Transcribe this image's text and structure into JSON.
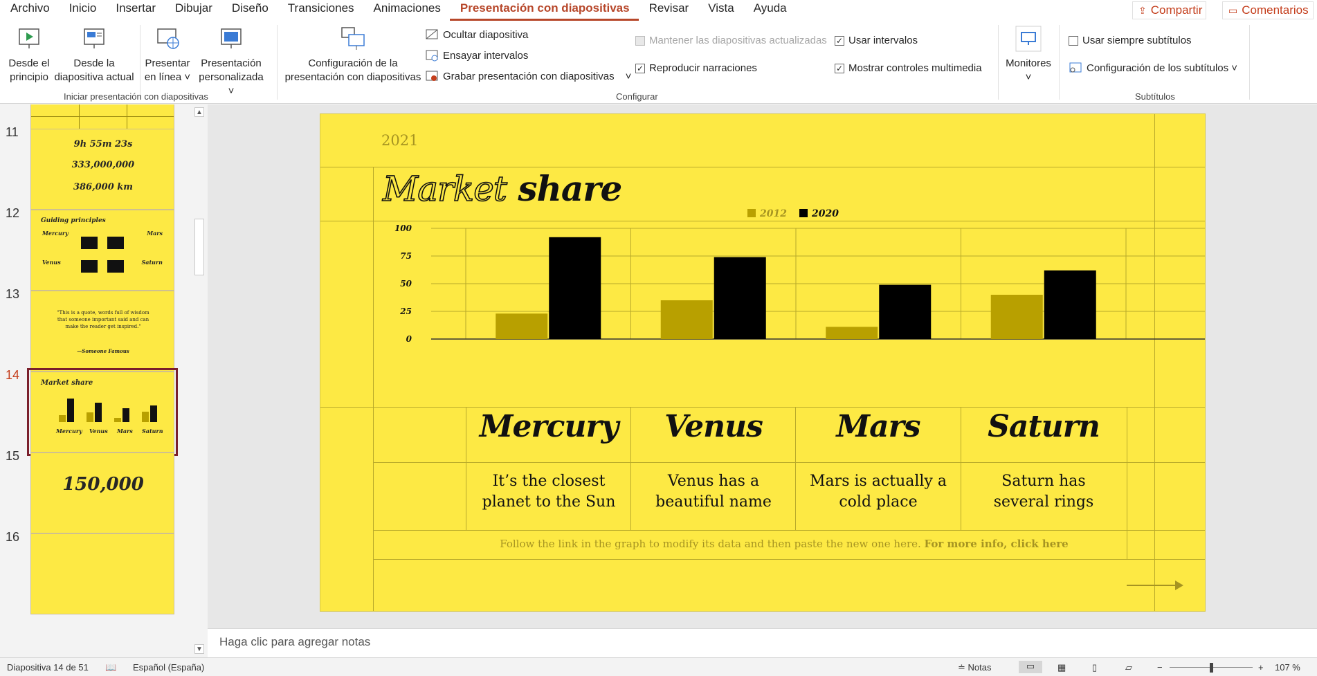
{
  "menu": {
    "tabs": [
      "Archivo",
      "Inicio",
      "Insertar",
      "Dibujar",
      "Diseño",
      "Transiciones",
      "Animaciones",
      "Presentación con diapositivas",
      "Revisar",
      "Vista",
      "Ayuda"
    ],
    "active_tab": "Presentación con diapositivas",
    "share_label": "Compartir",
    "comments_label": "Comentarios"
  },
  "ribbon": {
    "start": {
      "from_beginning": [
        "Desde el",
        "principio"
      ],
      "from_current": [
        "Desde la",
        "diapositiva actual"
      ],
      "present_online": [
        "Presentar",
        "en línea ˅"
      ],
      "custom_show": [
        "Presentación",
        "personalizada ˅"
      ],
      "group_label": "Iniciar presentación con diapositivas"
    },
    "setup": {
      "config_show": [
        "Configuración de la",
        "presentación con diapositivas"
      ],
      "hide_slide": "Ocultar diapositiva",
      "rehearse": "Ensayar intervalos",
      "record": "Grabar presentación con diapositivas",
      "record_caret": "˅",
      "keep_updated": "Mantener las diapositivas actualizadas",
      "play_narrations": "Reproducir narraciones",
      "use_timings": "Usar intervalos",
      "show_media_controls": "Mostrar controles multimedia",
      "group_label": "Configurar"
    },
    "monitors": {
      "label": "Monitores",
      "caret": "˅"
    },
    "subtitles": {
      "always_use": "Usar siempre subtítulos",
      "settings": "Configuración de los subtítulos ˅",
      "group_label": "Subtítulos"
    }
  },
  "thumbnails": [
    {
      "num": "11",
      "lines": [
        "9h 55m 23s",
        "333,000,000",
        "386,000 km"
      ]
    },
    {
      "num": "12",
      "title": "Guiding principles",
      "labels": [
        "Mercury",
        "Mars",
        "Venus",
        "Saturn"
      ]
    },
    {
      "num": "13",
      "quote": "\"This is a quote, words full of wisdom that someone important said and can make the reader get inspired.\"",
      "author": "—Someone Famous"
    },
    {
      "num": "14",
      "title": "Market share",
      "labels": [
        "Mercury",
        "Venus",
        "Mars",
        "Saturn"
      ]
    },
    {
      "num": "15",
      "big": "150,000"
    },
    {
      "num": "16"
    }
  ],
  "active_thumbnail": "14",
  "slide": {
    "year": "2021",
    "title_outline": "Market",
    "title_bold": "share",
    "planets": [
      {
        "name": "Mercury",
        "desc": [
          "It’s the closest",
          "planet to the Sun"
        ]
      },
      {
        "name": "Venus",
        "desc": [
          "Venus has a",
          "beautiful name"
        ]
      },
      {
        "name": "Mars",
        "desc": [
          "Mars is actually a",
          "cold place"
        ]
      },
      {
        "name": "Saturn",
        "desc": [
          "Saturn has",
          "several rings"
        ]
      }
    ],
    "footer_text": "Follow the link in the graph to modify its data and then paste the new one here. ",
    "footer_link": "For more info, click here"
  },
  "chart_data": {
    "type": "bar",
    "categories": [
      "Mercury",
      "Venus",
      "Mars",
      "Saturn"
    ],
    "series": [
      {
        "name": "2012",
        "values": [
          23,
          35,
          11,
          40
        ],
        "color": "#b8a000"
      },
      {
        "name": "2020",
        "values": [
          92,
          74,
          49,
          62
        ],
        "color": "#000000"
      }
    ],
    "ylim": [
      0,
      100
    ],
    "yticks": [
      0,
      25,
      50,
      75,
      100
    ],
    "legend": "top-center"
  },
  "notes_placeholder": "Haga clic para agregar notas",
  "status": {
    "slide_info": "Diapositiva 14 de 51",
    "language": "Español (España)",
    "notes_label": "Notas",
    "zoom": "107 %"
  }
}
